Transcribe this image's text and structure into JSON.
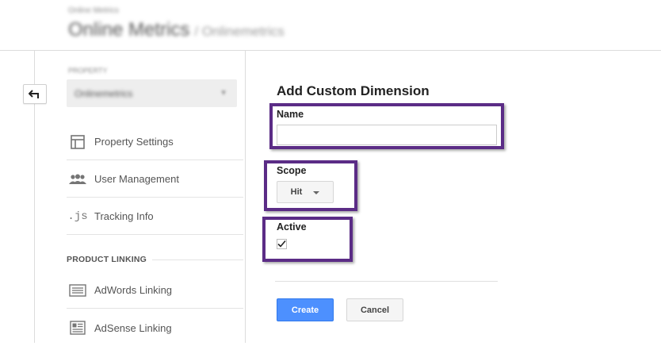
{
  "header": {
    "account_name": "Online Metrics",
    "property_title": "Online Metrics",
    "property_subtitle": "/ Onlinemetrics"
  },
  "sidebar": {
    "property_label": "PROPERTY",
    "property_value": "Onlinemetrics",
    "items": [
      {
        "label": "Property Settings",
        "icon": "property-settings-icon"
      },
      {
        "label": "User Management",
        "icon": "users-icon"
      },
      {
        "label": "Tracking Info",
        "icon": "js-icon",
        "icon_text": ".js"
      },
      {
        "label": "AdWords Linking",
        "icon": "adwords-icon"
      },
      {
        "label": "AdSense Linking",
        "icon": "adsense-icon"
      }
    ],
    "section_heading": "PRODUCT LINKING"
  },
  "form": {
    "title": "Add Custom Dimension",
    "name_label": "Name",
    "name_value": "",
    "scope_label": "Scope",
    "scope_value": "Hit",
    "active_label": "Active",
    "active_checked": true,
    "create_label": "Create",
    "cancel_label": "Cancel"
  },
  "colors": {
    "highlight": "#5b2c86",
    "primary_button": "#4d90fe"
  }
}
